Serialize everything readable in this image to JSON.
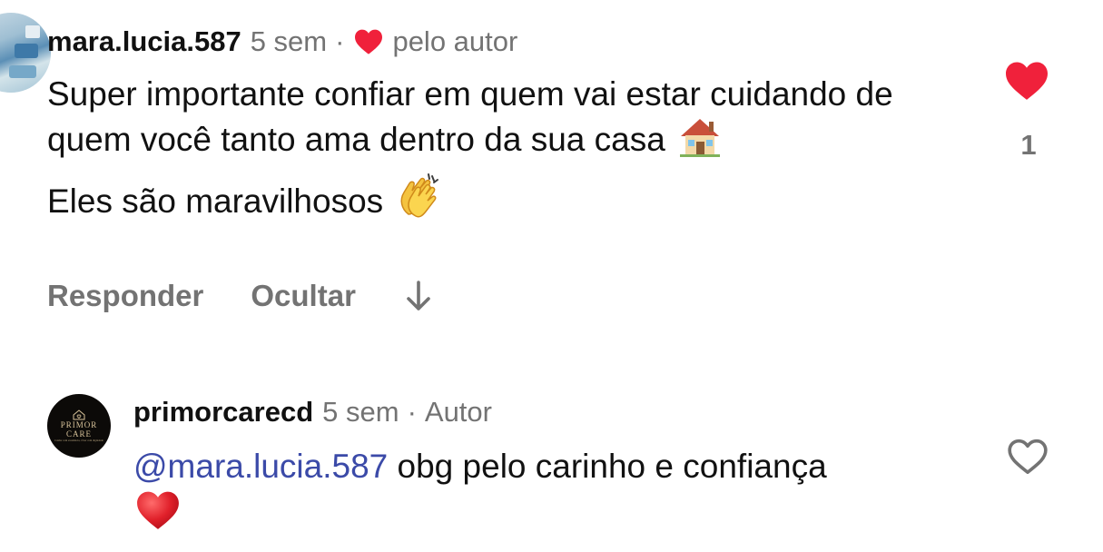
{
  "comment1": {
    "username": "mara.lucia.587",
    "time": "5 sem",
    "separator": "·",
    "liked_by_author_label": "pelo autor",
    "text_line1": "Super importante confiar em quem vai estar cuidando de quem você tanto ama dentro da sua casa",
    "emoji_house": "house-emoji",
    "text_line2": "Eles são maravilhosos",
    "emoji_clap": "clapping-hands-emoji",
    "reply_label": "Responder",
    "hide_label": "Ocultar",
    "like_count": "1",
    "liked": true,
    "colors": {
      "heart": "#f0213b",
      "muted": "#737373"
    }
  },
  "comment2": {
    "username": "primorcarecd",
    "time": "5 sem",
    "separator": "·",
    "author_label": "Autor",
    "mention": "@mara.lucia.587",
    "text": "obg pelo carinho e confiança",
    "emoji_heart": "red-heart-emoji",
    "avatar": {
      "brand_line1": "PRIMOR",
      "brand_line2": "CARE",
      "tagline": "Cuidar com excelência, viver com dignidade"
    },
    "liked": false,
    "colors": {
      "mention": "#3b4aa8"
    }
  }
}
